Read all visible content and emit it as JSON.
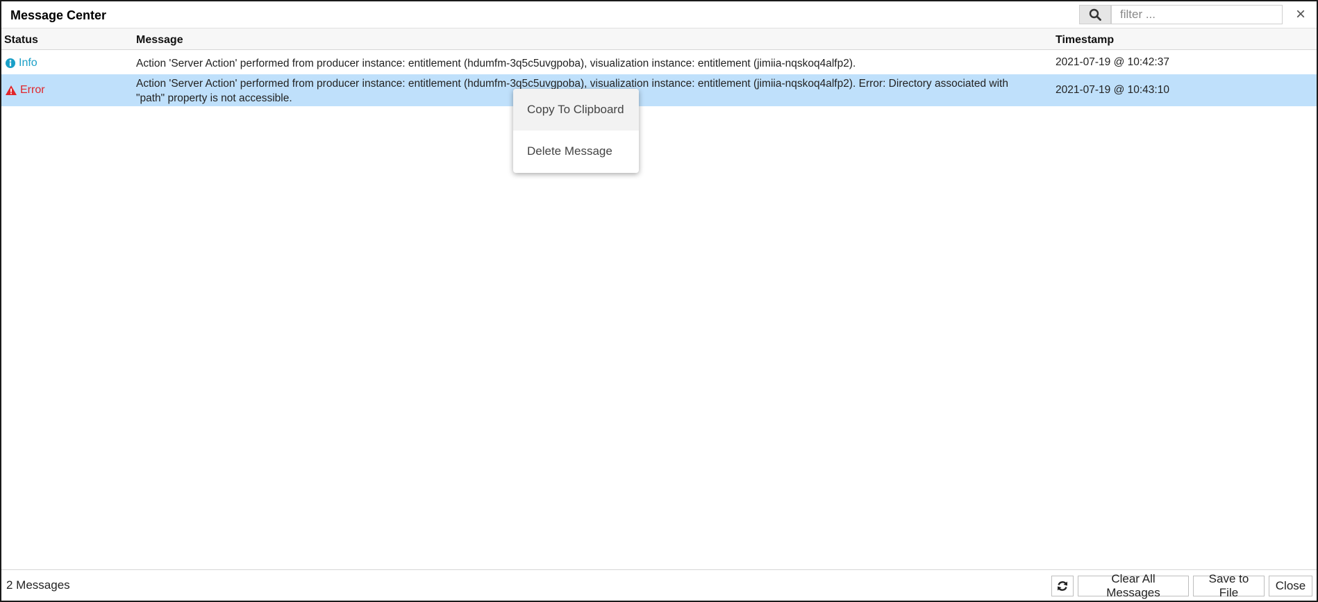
{
  "window": {
    "title": "Message Center"
  },
  "search": {
    "placeholder": "filter ...",
    "value": ""
  },
  "table": {
    "headers": {
      "status": "Status",
      "message": "Message",
      "timestamp": "Timestamp"
    },
    "rows": [
      {
        "status": "Info",
        "status_icon": "info-circle-icon",
        "message": "Action 'Server Action' performed from producer instance: entitlement (hdumfm-3q5c5uvgpoba), visualization instance: entitlement (jimiia-nqskoq4alfp2).",
        "timestamp": "2021-07-19 @ 10:42:37",
        "selected": false
      },
      {
        "status": "Error",
        "status_icon": "warning-triangle-icon",
        "message": "Action 'Server Action' performed from producer instance: entitlement (hdumfm-3q5c5uvgpoba), visualization instance: entitlement (jimiia-nqskoq4alfp2). Error: Directory associated with \"path\" property is not accessible.",
        "timestamp": "2021-07-19 @ 10:43:10",
        "selected": true
      }
    ]
  },
  "context_menu": {
    "items": [
      "Copy To Clipboard",
      "Delete Message"
    ]
  },
  "footer": {
    "count": "2 Messages",
    "clear_label": "Clear All Messages",
    "save_label": "Save to File",
    "close_label": "Close"
  },
  "colors": {
    "info": "#1a9fc7",
    "error": "#e0262b",
    "selected_row": "#bfe0fb"
  }
}
